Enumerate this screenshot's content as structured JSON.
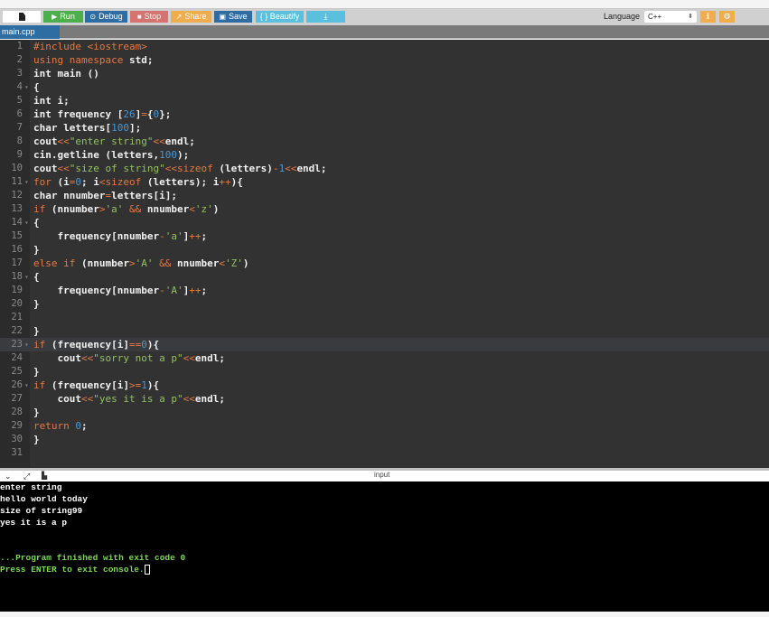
{
  "toolbar": {
    "run_label": "Run",
    "debug_label": "Debug",
    "stop_label": "Stop",
    "share_label": "Share",
    "save_label": "Save",
    "beautify_label": "{ } Beautify",
    "run_icon": "▶",
    "debug_icon": "⊙",
    "stop_icon": "■",
    "share_icon": "↗",
    "save_icon": "💾",
    "download_icon": "⤓",
    "language_label": "Language",
    "language_value": "C++",
    "info_icon": "ℹ",
    "settings_icon": "⚙"
  },
  "tabs": [
    {
      "label": "main.cpp"
    }
  ],
  "editor": {
    "active_line": 23,
    "lines": [
      {
        "n": "1",
        "html": "<span class='pre'>#include &lt;iostream&gt;</span>"
      },
      {
        "n": "2",
        "html": "<span class='kw'>using namespace</span> std;"
      },
      {
        "n": "3",
        "html": "int main ()"
      },
      {
        "n": "4",
        "fold": true,
        "html": "{"
      },
      {
        "n": "5",
        "html": "int i;"
      },
      {
        "n": "6",
        "html": "int frequency [<span class='num'>26</span>]<span class='op'>=</span>{<span class='num'>0</span>};"
      },
      {
        "n": "7",
        "html": "char letters[<span class='num'>100</span>];"
      },
      {
        "n": "8",
        "html": "cout<span class='op'>&lt;&lt;</span><span class='str'>\"enter string\"</span><span class='op'>&lt;&lt;</span>endl;"
      },
      {
        "n": "9",
        "html": "cin.getline (letters,<span class='num'>100</span>);"
      },
      {
        "n": "10",
        "html": "cout<span class='op'>&lt;&lt;</span><span class='str'>\"size of string\"</span><span class='op'>&lt;&lt;sizeof</span> (letters)<span class='op'>-</span><span class='num'>1</span><span class='op'>&lt;&lt;</span>endl;"
      },
      {
        "n": "11",
        "fold": true,
        "html": "<span class='kw'>for</span> (i<span class='op'>=</span><span class='num'>0</span>; i<span class='op'>&lt;sizeof</span> (letters); i<span class='op'>++</span>){"
      },
      {
        "n": "12",
        "html": "char nnumber<span class='op'>=</span>letters[i];"
      },
      {
        "n": "13",
        "html": "<span class='kw'>if</span> (nnumber<span class='op'>&gt;</span><span class='str'>'a'</span> <span class='op'>&amp;&amp;</span> nnumber<span class='op'>&lt;</span><span class='str'>'z'</span>)"
      },
      {
        "n": "14",
        "fold": true,
        "html": "{"
      },
      {
        "n": "15",
        "html": "    frequency[nnumber<span class='op'>-</span><span class='str'>'a'</span>]<span class='op'>++</span>;"
      },
      {
        "n": "16",
        "html": "}"
      },
      {
        "n": "17",
        "html": "<span class='kw'>else if</span> (nnumber<span class='op'>&gt;</span><span class='str'>'A'</span> <span class='op'>&amp;&amp;</span> nnumber<span class='op'>&lt;</span><span class='str'>'Z'</span>)"
      },
      {
        "n": "18",
        "fold": true,
        "html": "{"
      },
      {
        "n": "19",
        "html": "    frequency[nnumber<span class='op'>-</span><span class='str'>'A'</span>]<span class='op'>++</span>;"
      },
      {
        "n": "20",
        "html": "}"
      },
      {
        "n": "21",
        "html": ""
      },
      {
        "n": "22",
        "html": "}"
      },
      {
        "n": "23",
        "fold": true,
        "html": "<span class='kw'>if</span> (frequency[i]<span class='op'>==</span><span class='num'>0</span>){"
      },
      {
        "n": "24",
        "html": "    cout<span class='op'>&lt;&lt;</span><span class='str'>\"sorry not a p\"</span><span class='op'>&lt;&lt;</span>endl;"
      },
      {
        "n": "25",
        "html": "}"
      },
      {
        "n": "26",
        "fold": true,
        "html": "<span class='kw'>if</span> (frequency[i]<span class='op'>&gt;=</span><span class='num'>1</span>){"
      },
      {
        "n": "27",
        "html": "    cout<span class='op'>&lt;&lt;</span><span class='str'>\"yes it is a p\"</span><span class='op'>&lt;&lt;</span>endl;"
      },
      {
        "n": "28",
        "html": "}"
      },
      {
        "n": "29",
        "html": "<span class='kw'>return</span> <span class='num'>0</span>;"
      },
      {
        "n": "30",
        "html": "}"
      },
      {
        "n": "31",
        "html": ""
      }
    ]
  },
  "console_bar": {
    "collapse_icon": "⌄",
    "expand_icon": "⤢",
    "copy_icon": "📋",
    "input_label": "input"
  },
  "console": {
    "lines": [
      {
        "text": "enter string",
        "color": "white"
      },
      {
        "text": "hello world today",
        "color": "white"
      },
      {
        "text": "size of string99",
        "color": "white"
      },
      {
        "text": "yes it is a p",
        "color": "white"
      },
      {
        "text": "",
        "color": "white"
      },
      {
        "text": "",
        "color": "white"
      },
      {
        "text": "...Program finished with exit code 0",
        "color": "green"
      },
      {
        "text": "Press ENTER to exit console.",
        "color": "green",
        "cursor": true
      }
    ]
  }
}
